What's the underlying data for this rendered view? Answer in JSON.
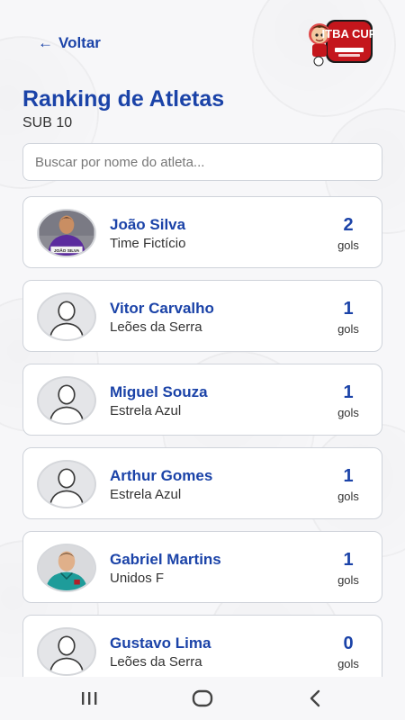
{
  "header": {
    "back_label": "Voltar",
    "back_icon": "arrow-left-icon",
    "logo_text": "ITBA CUP"
  },
  "page": {
    "title": "Ranking de Atletas",
    "subtitle": "SUB 10"
  },
  "search": {
    "placeholder": "Buscar por nome do atleta...",
    "value": ""
  },
  "athletes": [
    {
      "name": "João Silva",
      "team": "Time Fictício",
      "goals": "2",
      "goals_label": "gols",
      "photo": "kid-photo-purple",
      "photo_caption": "JOÃO SILVA"
    },
    {
      "name": "Vitor Carvalho",
      "team": "Leões da Serra",
      "goals": "1",
      "goals_label": "gols",
      "photo": "default-avatar"
    },
    {
      "name": "Miguel Souza",
      "team": "Estrela Azul",
      "goals": "1",
      "goals_label": "gols",
      "photo": "default-avatar"
    },
    {
      "name": "Arthur Gomes",
      "team": "Estrela Azul",
      "goals": "1",
      "goals_label": "gols",
      "photo": "default-avatar"
    },
    {
      "name": "Gabriel Martins",
      "team": "Unidos F",
      "goals": "1",
      "goals_label": "gols",
      "photo": "kid-photo-teal"
    },
    {
      "name": "Gustavo Lima",
      "team": "Leões da Serra",
      "goals": "0",
      "goals_label": "gols",
      "photo": "default-avatar"
    }
  ],
  "navbar": {
    "recent_icon": "recent-apps-icon",
    "home_icon": "home-icon",
    "back_icon": "back-chevron-icon"
  },
  "colors": {
    "accent": "#1b43a8",
    "background": "#f7f7f9",
    "card_border": "#cfd3da"
  }
}
